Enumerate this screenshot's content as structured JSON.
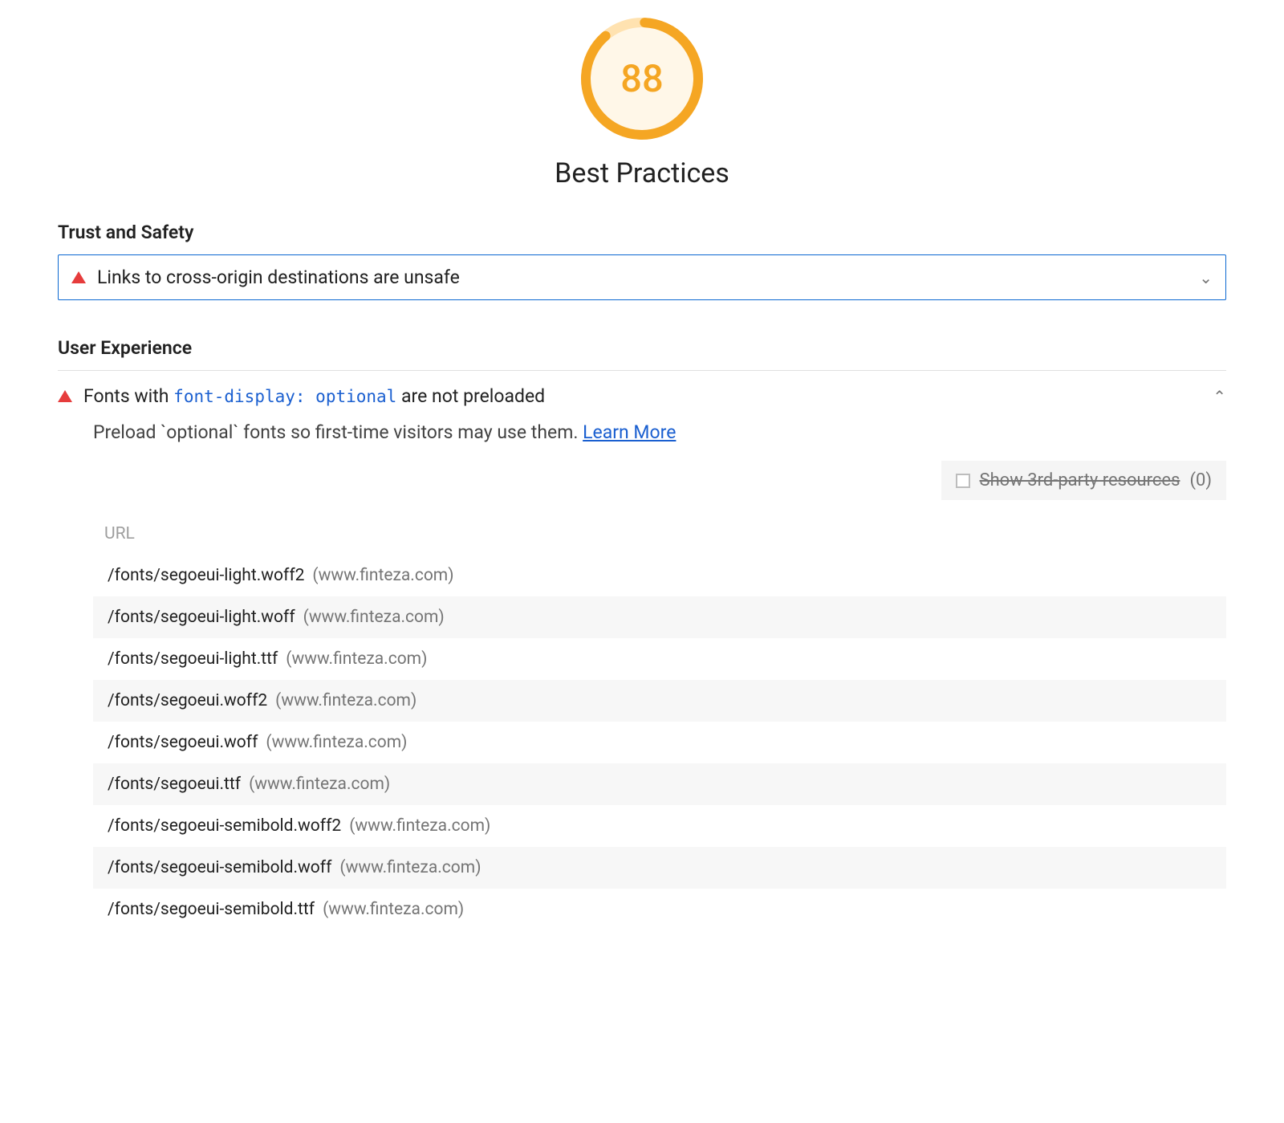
{
  "gauge": {
    "score": "88",
    "title": "Best Practices",
    "color": "#f5a623",
    "percent": 88
  },
  "section1": {
    "heading": "Trust and Safety",
    "audit": {
      "title": "Links to cross-origin destinations are unsafe"
    }
  },
  "section2": {
    "heading": "User Experience",
    "audit": {
      "title_pre": "Fonts with ",
      "title_code": "font-display: optional",
      "title_post": " are not preloaded",
      "description_pre": "Preload `optional` fonts so first-time visitors may use them. ",
      "learn_more": "Learn More"
    },
    "thirdParty": {
      "label": "Show 3rd-party resources",
      "count": "(0)"
    },
    "table": {
      "header": "URL",
      "rows": [
        {
          "path": "/fonts/segoeui-light.woff2",
          "host": "(www.finteza.com)"
        },
        {
          "path": "/fonts/segoeui-light.woff",
          "host": "(www.finteza.com)"
        },
        {
          "path": "/fonts/segoeui-light.ttf",
          "host": "(www.finteza.com)"
        },
        {
          "path": "/fonts/segoeui.woff2",
          "host": "(www.finteza.com)"
        },
        {
          "path": "/fonts/segoeui.woff",
          "host": "(www.finteza.com)"
        },
        {
          "path": "/fonts/segoeui.ttf",
          "host": "(www.finteza.com)"
        },
        {
          "path": "/fonts/segoeui-semibold.woff2",
          "host": "(www.finteza.com)"
        },
        {
          "path": "/fonts/segoeui-semibold.woff",
          "host": "(www.finteza.com)"
        },
        {
          "path": "/fonts/segoeui-semibold.ttf",
          "host": "(www.finteza.com)"
        }
      ]
    }
  }
}
